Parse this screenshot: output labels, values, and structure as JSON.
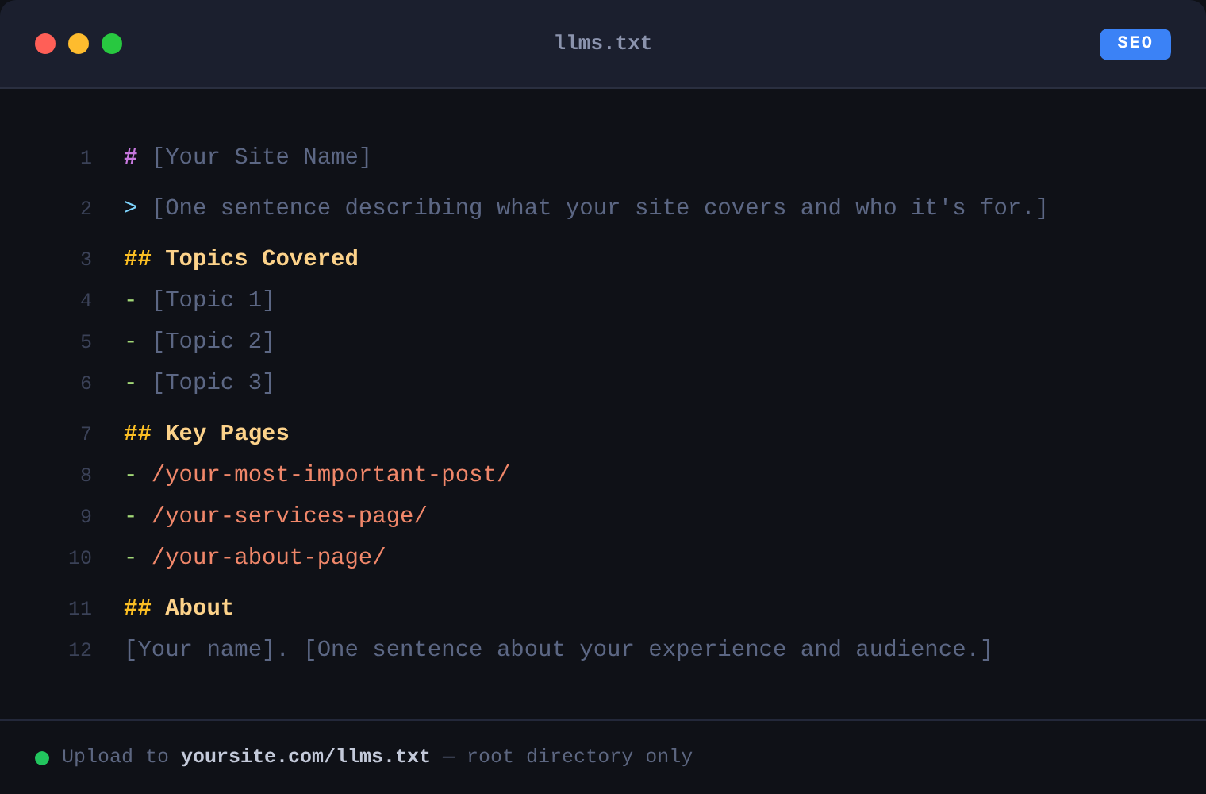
{
  "window": {
    "title": "llms.txt",
    "badge": "SEO"
  },
  "lines": [
    {
      "number": "1",
      "kind": "h1",
      "marker": "#",
      "text": "[Your Site Name]"
    },
    {
      "number": "2",
      "kind": "quote",
      "marker": ">",
      "text": "[One sentence describing what your site covers and who it's for.]"
    },
    {
      "number": "3",
      "kind": "h2",
      "marker": "##",
      "text": "Topics Covered"
    },
    {
      "number": "4",
      "kind": "item",
      "marker": "-",
      "text": "[Topic 1]"
    },
    {
      "number": "5",
      "kind": "item",
      "marker": "-",
      "text": "[Topic 2]"
    },
    {
      "number": "6",
      "kind": "item",
      "marker": "-",
      "text": "[Topic 3]"
    },
    {
      "number": "7",
      "kind": "h2",
      "marker": "##",
      "text": "Key Pages"
    },
    {
      "number": "8",
      "kind": "link",
      "marker": "-",
      "text": "/your-most-important-post/"
    },
    {
      "number": "9",
      "kind": "link",
      "marker": "-",
      "text": "/your-services-page/"
    },
    {
      "number": "10",
      "kind": "link",
      "marker": "-",
      "text": "/your-about-page/"
    },
    {
      "number": "11",
      "kind": "h2",
      "marker": "##",
      "text": "About"
    },
    {
      "number": "12",
      "kind": "text",
      "text": "[Your name]. [One sentence about your experience and audience.]"
    }
  ],
  "footer": {
    "text": "Upload to **yoursite.com/llms.txt** — root directory only"
  }
}
